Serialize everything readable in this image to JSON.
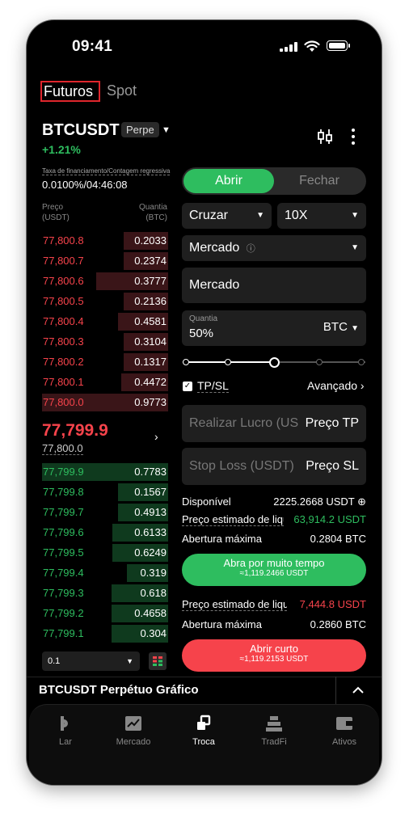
{
  "status": {
    "time": "09:41"
  },
  "tabs": {
    "futures": "Futuros",
    "spot": "Spot"
  },
  "ticker": {
    "symbol": "BTCUSDT",
    "type": "Perpe",
    "change": "+1.21%"
  },
  "funding": {
    "label": "Taxa de financiamento/Contagem regressiva",
    "value": "0.0100%/04:46:08"
  },
  "orderbook": {
    "price_header": "Preço",
    "price_unit": "(USDT)",
    "qty_header": "Quantia",
    "qty_unit": "(BTC)",
    "asks": [
      {
        "price": "77,800.8",
        "qty": "0.2033",
        "depth": 0.35
      },
      {
        "price": "77,800.7",
        "qty": "0.2374",
        "depth": 0.35
      },
      {
        "price": "77,800.6",
        "qty": "0.3777",
        "depth": 0.57
      },
      {
        "price": "77,800.5",
        "qty": "0.2136",
        "depth": 0.35
      },
      {
        "price": "77,800.4",
        "qty": "0.4581",
        "depth": 0.4
      },
      {
        "price": "77,800.3",
        "qty": "0.3104",
        "depth": 0.35
      },
      {
        "price": "77,800.2",
        "qty": "0.1317",
        "depth": 0.35
      },
      {
        "price": "77,800.1",
        "qty": "0.4472",
        "depth": 0.37
      },
      {
        "price": "77,800.0",
        "qty": "0.9773",
        "depth": 1.0
      }
    ],
    "mid_price": "77,799.9",
    "mid_ref": "77,800.0",
    "bids": [
      {
        "price": "77,799.9",
        "qty": "0.7783",
        "depth": 1.0
      },
      {
        "price": "77,799.8",
        "qty": "0.1567",
        "depth": 0.4
      },
      {
        "price": "77,799.7",
        "qty": "0.4913",
        "depth": 0.4
      },
      {
        "price": "77,799.6",
        "qty": "0.6133",
        "depth": 0.44
      },
      {
        "price": "77,799.5",
        "qty": "0.6249",
        "depth": 0.44
      },
      {
        "price": "77,799.4",
        "qty": "0.319",
        "depth": 0.33
      },
      {
        "price": "77,799.3",
        "qty": "0.618",
        "depth": 0.45
      },
      {
        "price": "77,799.2",
        "qty": "0.4658",
        "depth": 0.45
      },
      {
        "price": "77,799.1",
        "qty": "0.304",
        "depth": 0.45
      }
    ],
    "depth_select": "0.1"
  },
  "order": {
    "open": "Abrir",
    "close": "Fechar",
    "margin_mode": "Cruzar",
    "leverage": "10X",
    "order_type": "Mercado",
    "price_field": "Mercado",
    "qty_label": "Quantia",
    "qty_value": "50%",
    "qty_unit": "BTC",
    "slider_fraction": 0.5,
    "tpsl_label": "TP/SL",
    "advanced": "Avançado",
    "tp_placeholder": "Realizar Lucro (USDT)",
    "tp_right": "Preço TP",
    "sl_placeholder": "Stop Loss (USDT)",
    "sl_right": "Preço SL",
    "available_label": "Disponível",
    "available_value": "2225.2668 USDT",
    "est_long_label": "Preço estimado de liquidação",
    "est_long_value": "63,914.2 USDT",
    "max_open_label": "Abertura máxima",
    "max_open_long": "0.2804 BTC",
    "long_button": "Abra por muito tempo",
    "long_button_sub": "≈1,119.2466 USDT",
    "est_short_label": "Preço estimado de liquidação",
    "est_short_value": "7,444.8 USDT",
    "max_open_short": "0.2860 BTC",
    "short_button": "Abrir curto",
    "short_button_sub": "≈1,119.2153 USDT"
  },
  "footer": {
    "title": "BTCUSDT Perpétuo Gráfico"
  },
  "nav": [
    {
      "label": "Lar",
      "icon": "home-icon"
    },
    {
      "label": "Mercado",
      "icon": "market-icon"
    },
    {
      "label": "Troca",
      "icon": "trade-icon"
    },
    {
      "label": "TradFi",
      "icon": "tradfi-icon"
    },
    {
      "label": "Ativos",
      "icon": "wallet-icon"
    }
  ],
  "colors": {
    "green": "#2ebd5f",
    "red": "#f6434b",
    "ask_bar": "#3a1518",
    "bid_bar": "#0f3a1e"
  }
}
